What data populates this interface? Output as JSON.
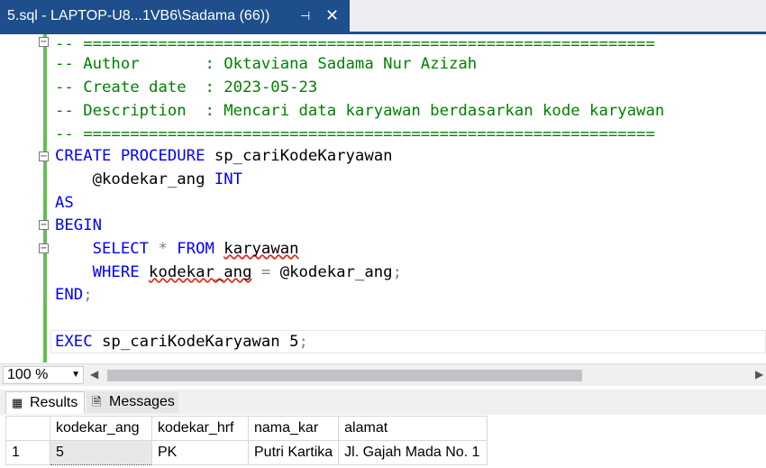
{
  "tab": {
    "title": "5.sql - LAPTOP-U8...1VB6\\Sadama (66))",
    "pin_icon": "pin-icon",
    "close_icon": "close-icon"
  },
  "editor": {
    "line1": "-- =============================================================",
    "line2": "-- Author       : Oktaviana Sadama Nur Azizah",
    "line3": "-- Create date  : 2023-05-23",
    "line4": "-- Description  : Mencari data karyawan berdasarkan kode karyawan",
    "line5": "-- =============================================================",
    "create_kw": "CREATE PROCEDURE",
    "proc_name": " sp_cariKodeKaryawan",
    "param_name": "    @kodekar_ang",
    "param_type": " INT",
    "as_kw": "AS",
    "begin_kw": "BEGIN",
    "select_kw": "    SELECT",
    "star": " * ",
    "from_kw": "FROM",
    "table_name": "karyawan",
    "where_kw": "    WHERE",
    "col_name": "kodekar_ang",
    "eq": " = ",
    "param_ref": "@kodekar_ang",
    "semi": ";",
    "end_kw": "END",
    "exec_kw": "EXEC",
    "exec_rest": " sp_cariKodeKaryawan 5",
    "exec_semi": ";"
  },
  "zoom": {
    "value": "100 %"
  },
  "results": {
    "tab_results": "Results",
    "tab_messages": "Messages",
    "columns": [
      "kodekar_ang",
      "kodekar_hrf",
      "nama_kar",
      "alamat"
    ],
    "rows": [
      {
        "num": "1",
        "cells": [
          "5",
          "PK",
          "Putri Kartika",
          "Jl. Gajah Mada No. 1"
        ]
      }
    ]
  }
}
